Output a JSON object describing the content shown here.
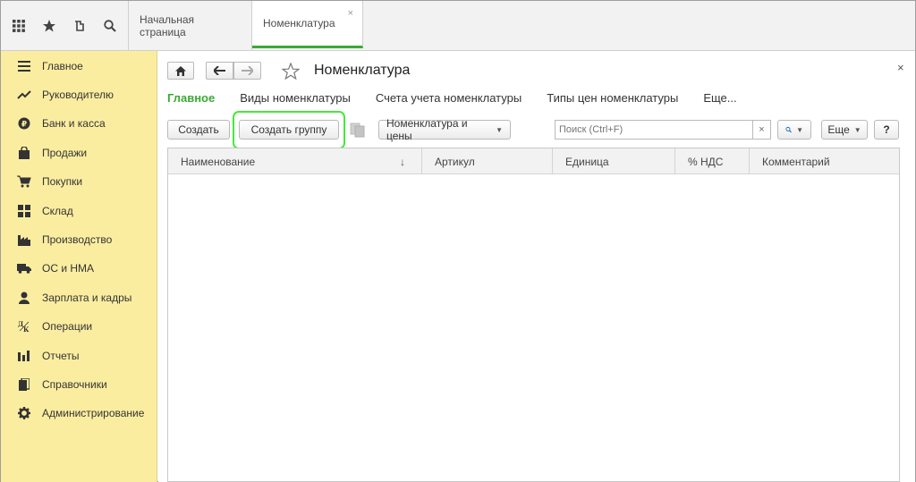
{
  "topbar": {
    "icons": [
      "apps-grid-icon",
      "star-icon",
      "history-icon",
      "search-icon"
    ],
    "tabs": [
      {
        "label": "Начальная страница",
        "active": false
      },
      {
        "label": "Номенклатура",
        "active": true
      }
    ]
  },
  "sidebar": {
    "items": [
      {
        "label": "Главное",
        "icon": "menu-lines-icon"
      },
      {
        "label": "Руководителю",
        "icon": "trend-icon"
      },
      {
        "label": "Банк и касса",
        "icon": "ruble-coin-icon"
      },
      {
        "label": "Продажи",
        "icon": "shopping-bag-icon"
      },
      {
        "label": "Покупки",
        "icon": "cart-icon"
      },
      {
        "label": "Склад",
        "icon": "warehouse-icon"
      },
      {
        "label": "Производство",
        "icon": "factory-icon"
      },
      {
        "label": "ОС и НМА",
        "icon": "truck-icon"
      },
      {
        "label": "Зарплата и кадры",
        "icon": "person-icon"
      },
      {
        "label": "Операции",
        "icon": "operations-icon"
      },
      {
        "label": "Отчеты",
        "icon": "bar-chart-icon"
      },
      {
        "label": "Справочники",
        "icon": "books-icon"
      },
      {
        "label": "Администрирование",
        "icon": "gear-icon"
      }
    ]
  },
  "main": {
    "title": "Номенклатура",
    "close": "×",
    "sections": [
      {
        "label": "Главное",
        "active": true
      },
      {
        "label": "Виды номенклатуры",
        "active": false
      },
      {
        "label": "Счета учета номенклатуры",
        "active": false
      },
      {
        "label": "Типы цен номенклатуры",
        "active": false
      },
      {
        "label": "Еще...",
        "active": false
      }
    ],
    "toolbar": {
      "create": "Создать",
      "create_group": "Создать группу",
      "prices": "Номенклатура и цены",
      "search_placeholder": "Поиск (Ctrl+F)",
      "search_clear": "×",
      "more": "Еще",
      "help": "?"
    },
    "table": {
      "columns": [
        "Наименование",
        "Артикул",
        "Единица",
        "% НДС",
        "Комментарий"
      ],
      "sort_indicator": "↓",
      "rows": []
    }
  },
  "colors": {
    "accent_green": "#3aaa35",
    "sidebar_bg": "#fbeda0",
    "highlight": "#45e83a"
  }
}
